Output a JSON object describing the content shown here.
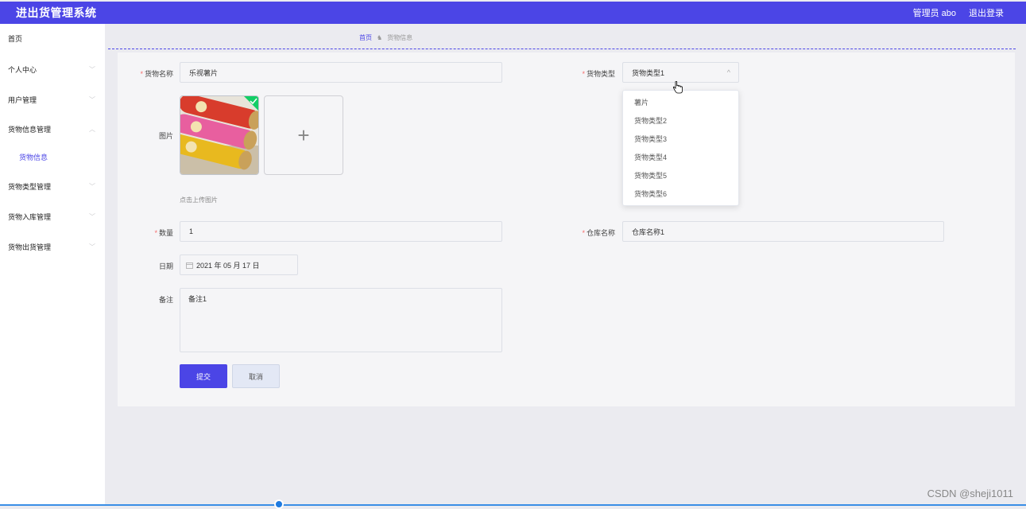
{
  "app": {
    "title": "进出货管理系统",
    "user": "管理员 abo",
    "logout": "退出登录"
  },
  "sidebar": {
    "items": [
      {
        "label": "首页"
      },
      {
        "label": "个人中心",
        "chevron": "﹀"
      },
      {
        "label": "用户管理",
        "chevron": "﹀"
      },
      {
        "label": "货物信息管理",
        "chevron": "︿"
      },
      {
        "label": "货物信息"
      },
      {
        "label": "货物类型管理",
        "chevron": "﹀"
      },
      {
        "label": "货物入库管理",
        "chevron": "﹀"
      },
      {
        "label": "货物出货管理",
        "chevron": "﹀"
      }
    ]
  },
  "breadcrumb": {
    "home": "首页",
    "sep": "♞",
    "current": "货物信息"
  },
  "form": {
    "name_label": "货物名称",
    "name_value": "乐视薯片",
    "type_label": "货物类型",
    "type_value": "货物类型1",
    "image_label": "图片",
    "upload_hint": "点击上传图片",
    "upload_plus": "+",
    "qty_label": "数量",
    "qty_value": "1",
    "warehouse_label": "仓库名称",
    "warehouse_value": "仓库名称1",
    "date_label": "日期",
    "date_value": "2021 年 05 月 17 日",
    "note_label": "备注",
    "note_value": "备注1",
    "submit": "提交",
    "cancel": "取消",
    "required_mark": "*",
    "select_arrow": "^"
  },
  "dropdown": {
    "options": [
      "薯片",
      "货物类型2",
      "货物类型3",
      "货物类型4",
      "货物类型5",
      "货物类型6"
    ]
  },
  "watermark": "CSDN @sheji1011"
}
